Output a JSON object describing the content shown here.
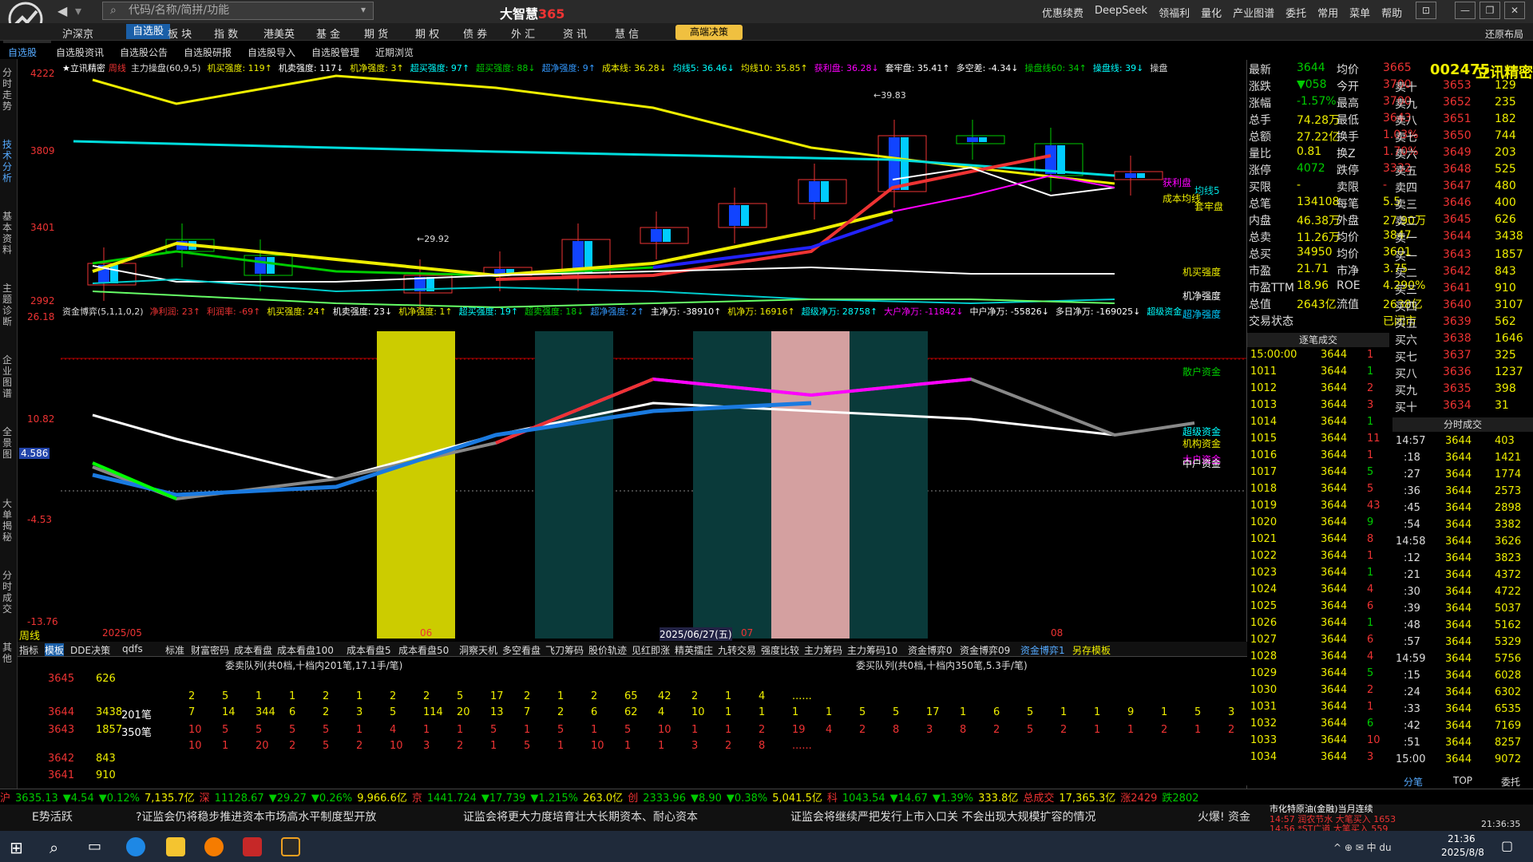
{
  "app": {
    "name": "大智慧",
    "name_suffix": "365",
    "search_placeholder": "代码/名称/简拼/功能"
  },
  "top_menu": [
    "优惠续费",
    "DeepSeek",
    "领福利",
    "量化",
    "产业图谱",
    "委托",
    "常用",
    "菜单",
    "帮助"
  ],
  "nav_tabs": [
    "沪深京",
    "自选股",
    "板 块",
    "指 数",
    "港美英",
    "基 金",
    "期 货",
    "期 权",
    "债 券",
    "外 汇",
    "资 讯",
    "慧 信"
  ],
  "nav_special": "高端决策",
  "nav_right": "还原布局",
  "sub_tabs": [
    "自选股",
    "自选股资讯",
    "自选股公告",
    "自选股研报",
    "自选股导入",
    "自选股管理",
    "近期浏览"
  ],
  "side_tabs": [
    "分时走势",
    "技术分析",
    "基本资料",
    "主题诊断",
    "企业图谱",
    "全景图",
    "大单揭秘",
    "分时成交",
    "其他"
  ],
  "chart": {
    "stock_label": "★立讯精密",
    "period": "周线",
    "legend1": [
      [
        "主力操盘(60,9,5)",
        "#ddd"
      ],
      [
        "机买强度: 119↑",
        "#ee0"
      ],
      [
        "机卖强度: 117↓",
        "#fff"
      ],
      [
        "机净强度: 3↑",
        "#ee0"
      ],
      [
        "超买强度: 97↑",
        "#0ff"
      ],
      [
        "超买强度: 88↓",
        "#0c0"
      ],
      [
        "超净强度: 9↑",
        "#39f"
      ],
      [
        "成本线: 36.28↓",
        "#ee0"
      ],
      [
        "均线5: 36.46↓",
        "#0ff"
      ],
      [
        "均线10: 35.85↑",
        "#ee0"
      ],
      [
        "获利盘: 36.28↓",
        "#f0f"
      ],
      [
        "套牢盘: 35.41↑",
        "#fff"
      ],
      [
        "多空差: -4.34↓",
        "#fff"
      ],
      [
        "操盘线60: 34↑",
        "#0c0"
      ],
      [
        "操盘线: 39↓",
        "#0ff"
      ],
      [
        "操盘",
        "#ddd"
      ]
    ],
    "legend2": [
      [
        "资金博弈(5,1,1,0,2)",
        "#ddd"
      ],
      [
        "净利润: 23↑",
        "#e33"
      ],
      [
        "利润率: -69↑",
        "#e33"
      ],
      [
        "机买强度: 24↑",
        "#ee0"
      ],
      [
        "机卖强度: 23↓",
        "#fff"
      ],
      [
        "机净强度: 1↑",
        "#ee0"
      ],
      [
        "超买强度: 19↑",
        "#0ff"
      ],
      [
        "超卖强度: 18↓",
        "#0c0"
      ],
      [
        "超净强度: 2↑",
        "#39f"
      ],
      [
        "主净万: -38910↑",
        "#fff"
      ],
      [
        "机净万: 16916↑",
        "#ee0"
      ],
      [
        "超级净万: 28758↑",
        "#0ff"
      ],
      [
        "大户净万: -11842↓",
        "#f0f"
      ],
      [
        "中户净万: -55826↓",
        "#fff"
      ],
      [
        "多日净万: -169025↓",
        "#fff"
      ],
      [
        "超级资金",
        "#0ff"
      ]
    ],
    "upper_axis": [
      "4222",
      "3809",
      "3401",
      "2992"
    ],
    "lower_axis": [
      "26.18",
      "10.82",
      "4.586",
      "-4.53",
      "-13.76"
    ],
    "x_labels": [
      "2025/05",
      "06",
      "2025/06/27(五)",
      "07",
      "08"
    ],
    "annotations": {
      "high": "39.83",
      "low": "29.92"
    },
    "right_labels_top": [
      "获利盘",
      "均线5",
      "成本均线",
      "套牢盘"
    ],
    "right_labels_low": [
      "机买强度",
      "机净强度",
      "超净强度",
      "散户资金",
      "超级资金",
      "机构资金",
      "大户资金",
      "中户资金"
    ]
  },
  "chart_data": {
    "type": "candlestick",
    "period": "周线",
    "ylim": [
      29.92,
      42.22
    ],
    "high": 39.83,
    "low": 29.92
  },
  "quote": {
    "code": "002475",
    "name": "立讯精密",
    "stats": [
      [
        "最新",
        "3644",
        "均价",
        "3665"
      ],
      [
        "涨跌",
        "▼058",
        "今开",
        "3700"
      ],
      [
        "涨幅",
        "-1.57%",
        "最高",
        "3700"
      ],
      [
        "总手",
        "74.28万",
        "最低",
        "3643"
      ],
      [
        "总额",
        "27.22亿",
        "换手",
        "1.03%"
      ],
      [
        "量比",
        "0.81",
        "换Z",
        "1.70%"
      ],
      [
        "涨停",
        "4072",
        "跌停",
        "3332"
      ],
      [
        "买限",
        "-",
        "卖限",
        "-"
      ],
      [
        "总笔",
        "134108",
        "每笔",
        "5.5"
      ],
      [
        "内盘",
        "46.38万",
        "外盘",
        "27.90万"
      ],
      [
        "总卖",
        "11.26万",
        "均价",
        "3847"
      ],
      [
        "总买",
        "34950",
        "均价",
        "3601"
      ],
      [
        "市盈",
        "21.71",
        "市净",
        "3.75"
      ],
      [
        "市盈TTM",
        "18.96",
        "ROE",
        "4.290%"
      ],
      [
        "总值",
        "2643亿",
        "流值",
        "2638亿"
      ],
      [
        "交易状态",
        "",
        "",
        "已闭市"
      ]
    ],
    "sell": [
      [
        "卖十",
        "3653",
        "129"
      ],
      [
        "卖九",
        "3652",
        "235"
      ],
      [
        "卖八",
        "3651",
        "182"
      ],
      [
        "卖七",
        "3650",
        "744"
      ],
      [
        "卖六",
        "3649",
        "203"
      ],
      [
        "卖五",
        "3648",
        "525"
      ],
      [
        "卖四",
        "3647",
        "480"
      ],
      [
        "卖三",
        "3646",
        "400"
      ],
      [
        "卖二",
        "3645",
        "626"
      ],
      [
        "卖一",
        "3644",
        "3438"
      ]
    ],
    "buy": [
      [
        "买一",
        "3643",
        "1857"
      ],
      [
        "买二",
        "3642",
        "843"
      ],
      [
        "买三",
        "3641",
        "910"
      ],
      [
        "买四",
        "3640",
        "3107"
      ],
      [
        "买五",
        "3639",
        "562"
      ],
      [
        "买六",
        "3638",
        "1646"
      ],
      [
        "买七",
        "3637",
        "325"
      ],
      [
        "买八",
        "3636",
        "1237"
      ],
      [
        "买九",
        "3635",
        "398"
      ],
      [
        "买十",
        "3634",
        "31"
      ]
    ],
    "trades_title": "逐笔成交",
    "trades": [
      [
        "15:00:00",
        "3644",
        "1"
      ],
      [
        "1011",
        "3644",
        "1"
      ],
      [
        "1012",
        "3644",
        "2"
      ],
      [
        "1013",
        "3644",
        "3"
      ],
      [
        "1014",
        "3644",
        "1"
      ],
      [
        "1015",
        "3644",
        "11"
      ],
      [
        "1016",
        "3644",
        "1"
      ],
      [
        "1017",
        "3644",
        "5"
      ],
      [
        "1018",
        "3644",
        "5"
      ],
      [
        "1019",
        "3644",
        "43"
      ],
      [
        "1020",
        "3644",
        "9"
      ],
      [
        "1021",
        "3644",
        "8"
      ],
      [
        "1022",
        "3644",
        "1"
      ],
      [
        "1023",
        "3644",
        "1"
      ],
      [
        "1024",
        "3644",
        "4"
      ],
      [
        "1025",
        "3644",
        "6"
      ],
      [
        "1026",
        "3644",
        "1"
      ],
      [
        "1027",
        "3644",
        "6"
      ],
      [
        "1028",
        "3644",
        "4"
      ],
      [
        "1029",
        "3644",
        "5"
      ],
      [
        "1030",
        "3644",
        "2"
      ],
      [
        "1031",
        "3644",
        "1"
      ],
      [
        "1032",
        "3644",
        "6"
      ],
      [
        "1033",
        "3644",
        "10"
      ],
      [
        "1034",
        "3644",
        "3"
      ]
    ],
    "minute_title": "分时成交",
    "minute": [
      [
        "14:57",
        "3644",
        "403"
      ],
      [
        ":18",
        "3644",
        "1421"
      ],
      [
        ":27",
        "3644",
        "1774"
      ],
      [
        ":36",
        "3644",
        "2573"
      ],
      [
        ":45",
        "3644",
        "2898"
      ],
      [
        ":54",
        "3644",
        "3382"
      ],
      [
        "14:58",
        "3644",
        "3626"
      ],
      [
        ":12",
        "3644",
        "3823"
      ],
      [
        ":21",
        "3644",
        "4372"
      ],
      [
        ":30",
        "3644",
        "4722"
      ],
      [
        ":39",
        "3644",
        "5037"
      ],
      [
        ":48",
        "3644",
        "5162"
      ],
      [
        ":57",
        "3644",
        "5329"
      ],
      [
        "14:59",
        "3644",
        "5756"
      ],
      [
        ":15",
        "3644",
        "6028"
      ],
      [
        ":24",
        "3644",
        "6302"
      ],
      [
        ":33",
        "3644",
        "6535"
      ],
      [
        ":42",
        "3644",
        "7169"
      ],
      [
        ":51",
        "3644",
        "8257"
      ],
      [
        "15:00",
        "3644",
        "9072"
      ]
    ],
    "bottom_tabs": [
      "分笔",
      "TOP",
      "委托"
    ]
  },
  "bottom_tabs": [
    "指标",
    "模板",
    "DDE决策",
    "qdfs",
    "标准",
    "财富密码",
    "成本看盘",
    "成本看盘100",
    "成本看盘5",
    "成本看盘50",
    "洞察天机",
    "多空看盘",
    "飞刀筹码",
    "股价轨迹",
    "见红即涨",
    "精英擂庄",
    "九转交易",
    "强度比较",
    "主力筹码",
    "主力筹码10",
    "资金博弈0",
    "资金博弈09",
    "资金博弈1",
    "另存模板"
  ],
  "queue": {
    "left_title": "委卖队列(共0档,十档内201笔,17.1手/笔)",
    "right_title": "委买队列(共0档,十档内350笔,5.3手/笔)",
    "left_rows": [
      [
        "3645",
        "626",
        ""
      ],
      [
        "3644",
        "3438",
        "201笔"
      ],
      [
        "3643",
        "1857",
        "350笔"
      ],
      [
        "3642",
        "843",
        ""
      ],
      [
        "3641",
        "910",
        ""
      ]
    ],
    "row1": [
      "2",
      "5",
      "1",
      "1",
      "2",
      "1",
      "2",
      "2",
      "5",
      "17",
      "2",
      "1",
      "2",
      "65",
      "42",
      "2",
      "1",
      "4",
      "......"
    ],
    "row2": [
      "7",
      "14",
      "344",
      "6",
      "2",
      "3",
      "5",
      "114",
      "20",
      "13",
      "7",
      "2",
      "6",
      "62",
      "4",
      "10",
      "1",
      "1",
      "1",
      "1",
      "5",
      "5",
      "17",
      "1",
      "6",
      "5",
      "1",
      "1",
      "9",
      "1",
      "5",
      "3"
    ],
    "row3": [
      "10",
      "5",
      "5",
      "5",
      "5",
      "1",
      "4",
      "1",
      "1",
      "5",
      "1",
      "5",
      "1",
      "5",
      "10",
      "1",
      "1",
      "2",
      "19",
      "4",
      "2",
      "8",
      "3",
      "8",
      "2",
      "5",
      "2",
      "1",
      "1",
      "2",
      "1",
      "2"
    ],
    "row4": [
      "10",
      "1",
      "20",
      "2",
      "5",
      "2",
      "10",
      "3",
      "2",
      "1",
      "5",
      "1",
      "10",
      "1",
      "1",
      "3",
      "2",
      "8",
      "......"
    ]
  },
  "ticker": [
    [
      "沪",
      "#e33"
    ],
    [
      "3635.13",
      "#0c0"
    ],
    [
      "▼4.54",
      "#0c0"
    ],
    [
      "▼0.12%",
      "#0c0"
    ],
    [
      "7,135.7亿",
      "#ee0"
    ],
    [
      "深",
      "#e33"
    ],
    [
      "11128.67",
      "#0c0"
    ],
    [
      "▼29.27",
      "#0c0"
    ],
    [
      "▼0.26%",
      "#0c0"
    ],
    [
      "9,966.6亿",
      "#ee0"
    ],
    [
      "京",
      "#e33"
    ],
    [
      "1441.724",
      "#0c0"
    ],
    [
      "▼17.739",
      "#0c0"
    ],
    [
      "▼1.215%",
      "#0c0"
    ],
    [
      "263.0亿",
      "#ee0"
    ],
    [
      "创",
      "#e33"
    ],
    [
      "2333.96",
      "#0c0"
    ],
    [
      "▼8.90",
      "#0c0"
    ],
    [
      "▼0.38%",
      "#0c0"
    ],
    [
      "5,041.5亿",
      "#ee0"
    ],
    [
      "科",
      "#e33"
    ],
    [
      "1043.54",
      "#0c0"
    ],
    [
      "▼14.67",
      "#0c0"
    ],
    [
      "▼1.39%",
      "#0c0"
    ],
    [
      "333.8亿",
      "#ee0"
    ],
    [
      "总成交",
      "#e33"
    ],
    [
      "17,365.3亿",
      "#ee0"
    ],
    [
      "涨2429",
      "#e33"
    ],
    [
      "跌2802",
      "#0c0"
    ]
  ],
  "news": [
    "E势活跃",
    "?证监会仍将稳步推进资本市场高水平制度型开放",
    "证监会将更大力度培育壮大长期资本、耐心资本",
    "证监会将继续严把发行上市入口关 不会出现大规模扩容的情况",
    "火爆! 资金"
  ],
  "news_right": [
    "市化特原油(金融)当月连续",
    "14:57 润农节水 大笔买入 1653",
    "14:56 *ST广道 大笔买入 559"
  ],
  "clock": {
    "time": "21:36",
    "date": "2025/8/8",
    "chart_time": "21:36:35"
  }
}
